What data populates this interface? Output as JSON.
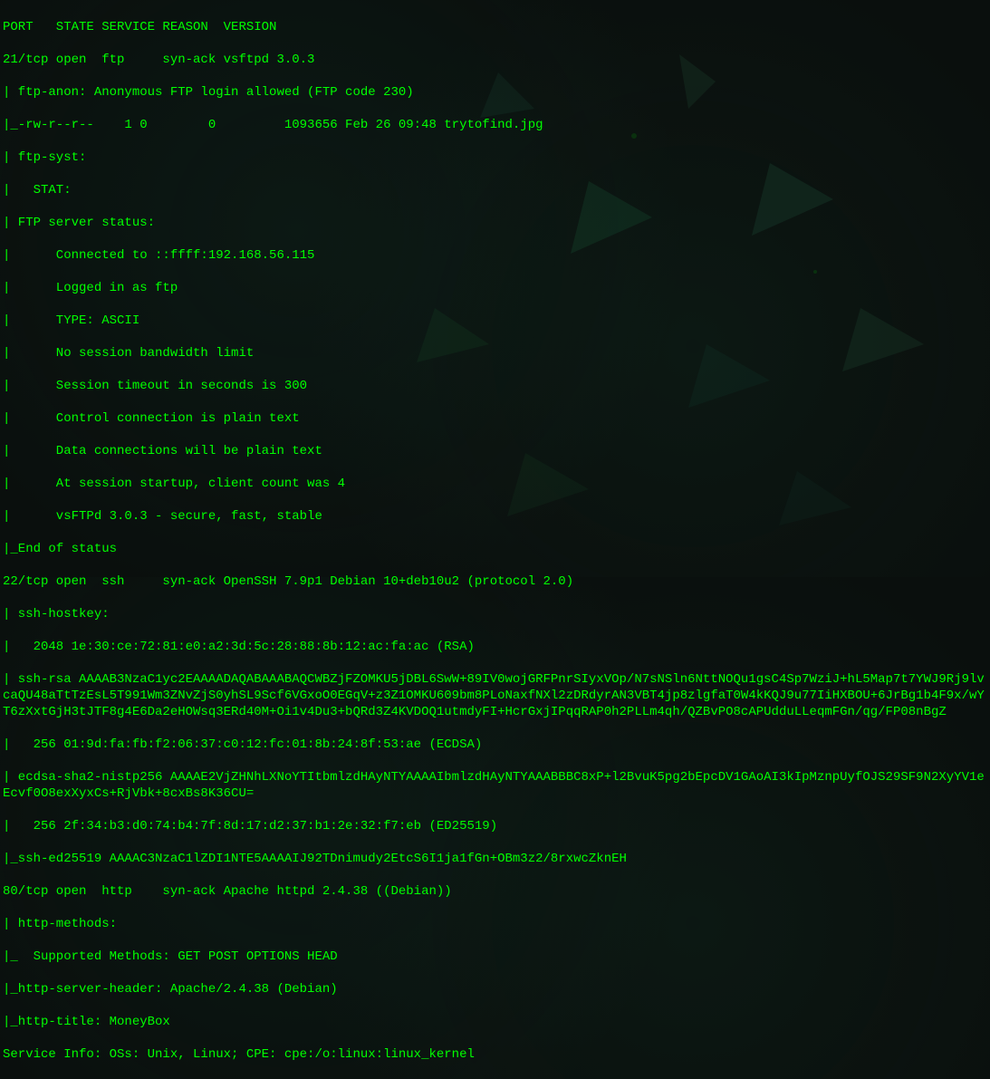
{
  "header": "PORT   STATE SERVICE REASON  VERSION",
  "port21": {
    "line": "21/tcp open  ftp     syn-ack vsftpd 3.0.3",
    "anon": "| ftp-anon: Anonymous FTP login allowed (FTP code 230)",
    "file": "|_-rw-r--r--    1 0        0         1093656 Feb 26 09:48 trytofind.jpg",
    "syst": "| ftp-syst:",
    "stat": "|   STAT:",
    "status_header": "| FTP server status:",
    "s1": "|      Connected to ::ffff:192.168.56.115",
    "s2": "|      Logged in as ftp",
    "s3": "|      TYPE: ASCII",
    "s4": "|      No session bandwidth limit",
    "s5": "|      Session timeout in seconds is 300",
    "s6": "|      Control connection is plain text",
    "s7": "|      Data connections will be plain text",
    "s8": "|      At session startup, client count was 4",
    "s9": "|      vsFTPd 3.0.3 - secure, fast, stable",
    "end": "|_End of status"
  },
  "port22": {
    "line": "22/tcp open  ssh     syn-ack OpenSSH 7.9p1 Debian 10+deb10u2 (protocol 2.0)",
    "hostkey": "| ssh-hostkey:",
    "rsa_fp": "|   2048 1e:30:ce:72:81:e0:a2:3d:5c:28:88:8b:12:ac:fa:ac (RSA)",
    "rsa_key": "| ssh-rsa AAAAB3NzaC1yc2EAAAADAQABAAABAQCWBZjFZOMKU5jDBL6SwW+89IV0wojGRFPnrSIyxVOp/N7sNSln6NttNOQu1gsC4Sp7WziJ+hL5Map7t7YWJ9Rj9lvcaQU48aTtTzEsL5T991Wm3ZNvZjS0yhSL9Scf6VGxoO0EGqV+z3Z1OMKU609bm8PLoNaxfNXl2zDRdyrAN3VBT4jp8zlgfaT0W4kKQJ9u77IiHXBOU+6JrBg1b4F9x/wYT6zXxtGjH3tJTF8g4E6Da2eHOWsq3ERd40M+Oi1v4Du3+bQRd3Z4KVDOQ1utmdyFI+HcrGxjIPqqRAP0h2PLLm4qh/QZBvPO8cAPUdduLLeqmFGn/qg/FP08nBgZ",
    "ecdsa_fp": "|   256 01:9d:fa:fb:f2:06:37:c0:12:fc:01:8b:24:8f:53:ae (ECDSA)",
    "ecdsa_key": "| ecdsa-sha2-nistp256 AAAAE2VjZHNhLXNoYTItbmlzdHAyNTYAAAAIbmlzdHAyNTYAAABBBC8xP+l2BvuK5pg2bEpcDV1GAoAI3kIpMznpUyfOJS29SF9N2XyYV1eEcvf0O8exXyxCs+RjVbk+8cxBs8K36CU=",
    "ed25519_fp": "|   256 2f:34:b3:d0:74:b4:7f:8d:17:d2:37:b1:2e:32:f7:eb (ED25519)",
    "ed25519_key": "|_ssh-ed25519 AAAAC3NzaC1lZDI1NTE5AAAAIJ92TDnimudy2EtcS6I1ja1fGn+OBm3z2/8rxwcZknEH"
  },
  "port80": {
    "line": "80/tcp open  http    syn-ack Apache httpd 2.4.38 ((Debian))",
    "methods": "| http-methods:",
    "supported": "|_  Supported Methods: GET POST OPTIONS HEAD",
    "server_header": "|_http-server-header: Apache/2.4.38 (Debian)",
    "title": "|_http-title: MoneyBox"
  },
  "service_info": "Service Info: OSs: Unix, Linux; CPE: cpe:/o:linux:linux_kernel"
}
